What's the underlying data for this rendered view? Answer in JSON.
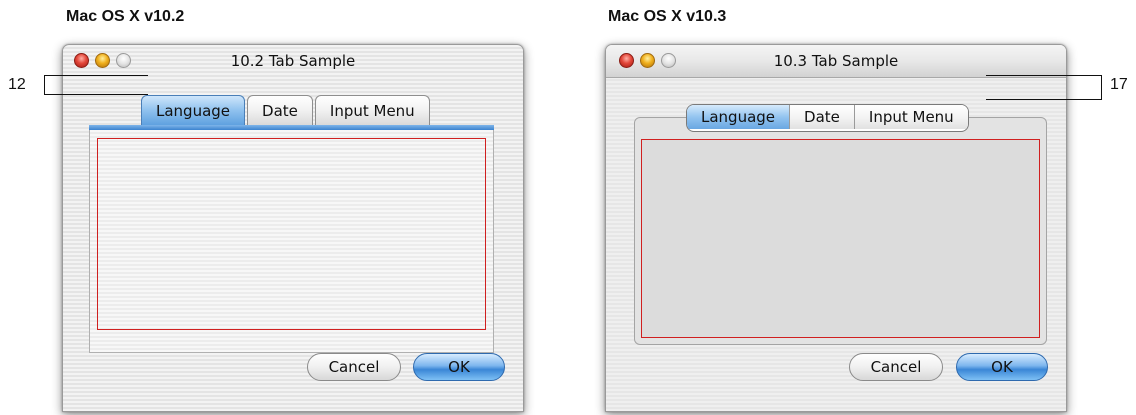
{
  "captions": {
    "left": "Mac OS X v10.2",
    "right": "Mac OS X v10.3"
  },
  "window_102": {
    "title": "10.2 Tab Sample",
    "tabs": [
      {
        "label": "Language",
        "selected": true
      },
      {
        "label": "Date",
        "selected": false
      },
      {
        "label": "Input Menu",
        "selected": false
      }
    ],
    "cancel_label": "Cancel",
    "ok_label": "OK"
  },
  "window_103": {
    "title": "10.3 Tab Sample",
    "tabs": [
      {
        "label": "Language",
        "selected": true
      },
      {
        "label": "Date",
        "selected": false
      },
      {
        "label": "Input Menu",
        "selected": false
      }
    ],
    "cancel_label": "Cancel",
    "ok_label": "OK"
  },
  "measurements": {
    "left": "12",
    "right": "17"
  },
  "colors": {
    "selected_tab": "#6aa7e2",
    "ok_button": "#3a86d6",
    "content_outline": "#d02020"
  }
}
